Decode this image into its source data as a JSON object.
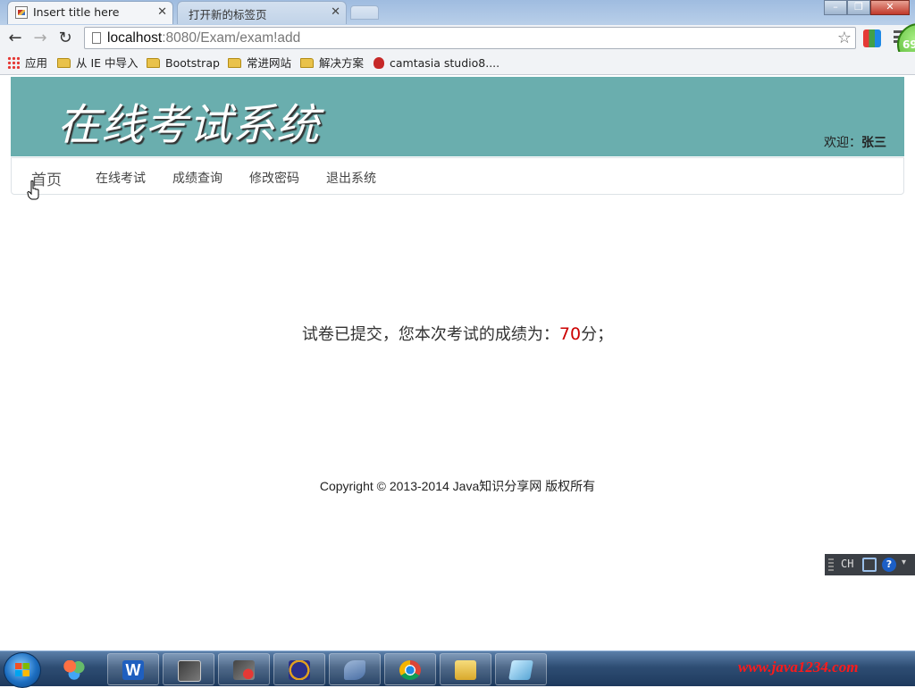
{
  "browser": {
    "tabs": [
      {
        "title": "Insert title here",
        "active": true
      },
      {
        "title": "打开新的标签页",
        "active": false
      }
    ],
    "url_host": "localhost",
    "url_path": ":8080/Exam/exam!add",
    "badge": "69",
    "bookmarks": [
      {
        "label": "应用",
        "icon": "apps-icon"
      },
      {
        "label": "从 IE 中导入",
        "icon": "folder-icon"
      },
      {
        "label": "Bootstrap",
        "icon": "folder-icon"
      },
      {
        "label": "常进网站",
        "icon": "folder-icon"
      },
      {
        "label": "解决方案",
        "icon": "folder-icon"
      },
      {
        "label": "camtasia studio8....",
        "icon": "camtasia-icon"
      }
    ]
  },
  "site": {
    "title": "在线考试系统",
    "welcome_label": "欢迎：",
    "user_name": "张三",
    "header_color": "#6aaeae"
  },
  "nav": {
    "items": [
      "首页",
      "在线考试",
      "成绩查询",
      "修改密码",
      "退出系统"
    ]
  },
  "result": {
    "prefix": "试卷已提交，您本次考试的成绩为：",
    "score": "70",
    "suffix": "分；",
    "score_color": "#cc0000"
  },
  "footer": {
    "copyright": "Copyright © 2013-2014 Java知识分享网 版权所有"
  },
  "ime": {
    "lang": "CH"
  },
  "taskbar": {
    "brand_text": "www.java1234.com"
  }
}
